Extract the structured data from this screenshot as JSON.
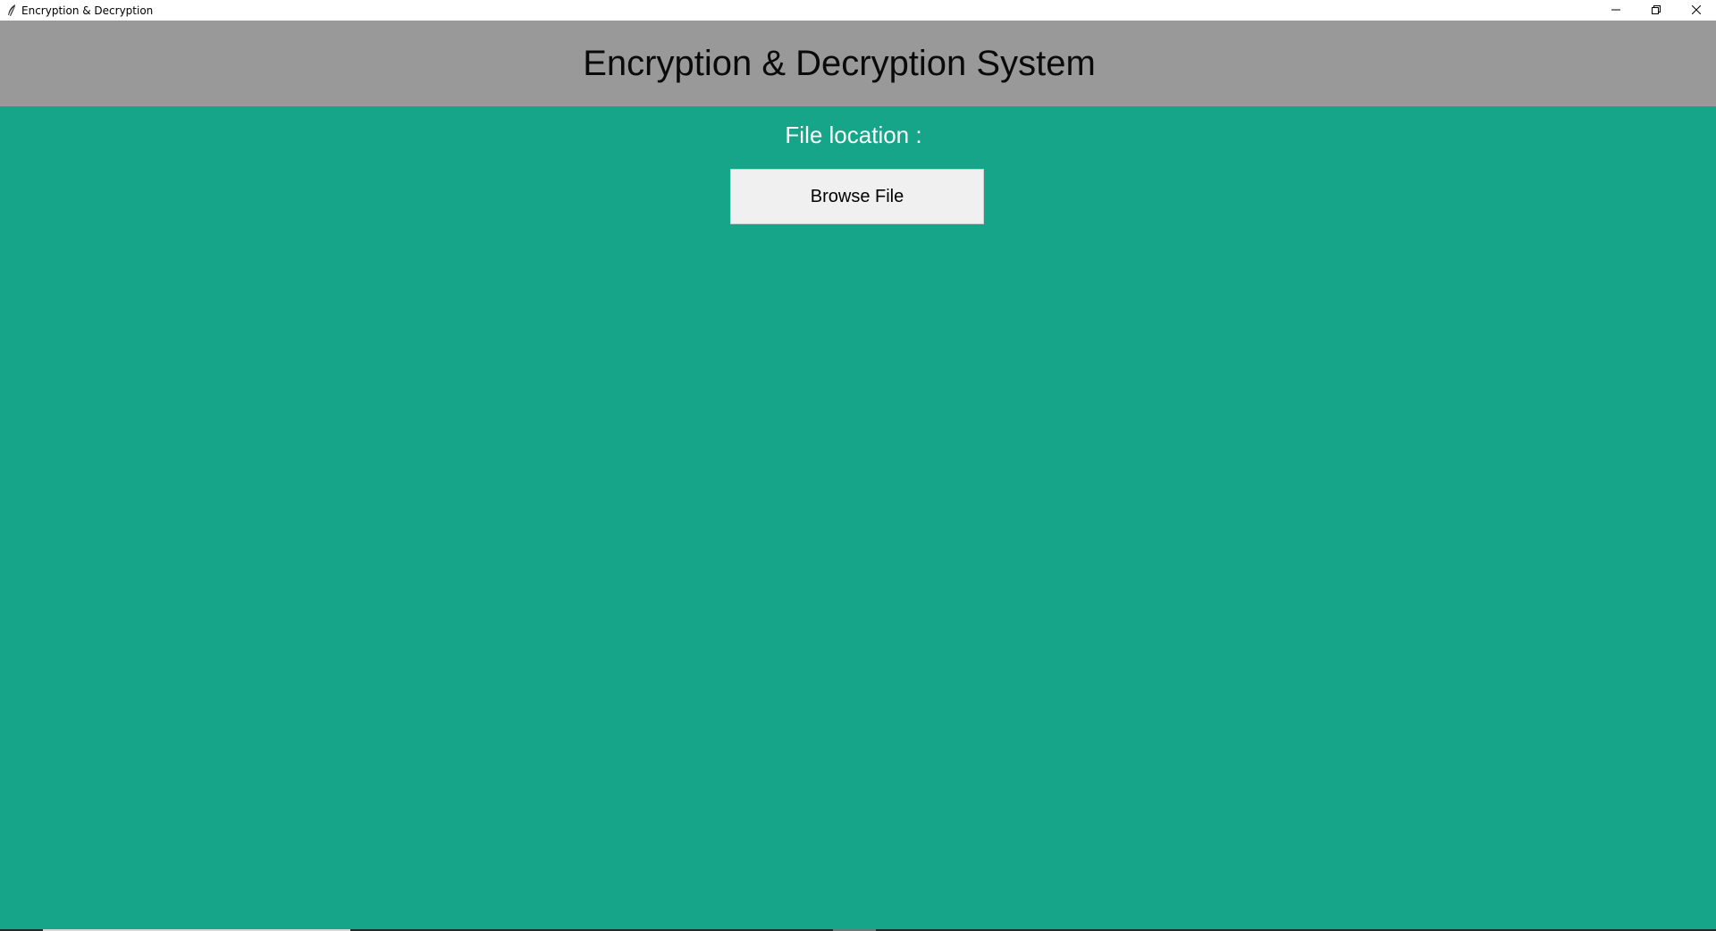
{
  "window": {
    "title": "Encryption & Decryption",
    "controls": {
      "minimize": "minimize-icon",
      "restore": "restore-icon",
      "close": "close-icon"
    }
  },
  "header": {
    "title": "Encryption & Decryption System"
  },
  "main": {
    "file_label": "File location :",
    "browse_button_label": "Browse File"
  },
  "colors": {
    "background": "#17a589",
    "header_background": "#999999",
    "button_background": "#f0f0f0",
    "label_text": "#ffffff"
  }
}
